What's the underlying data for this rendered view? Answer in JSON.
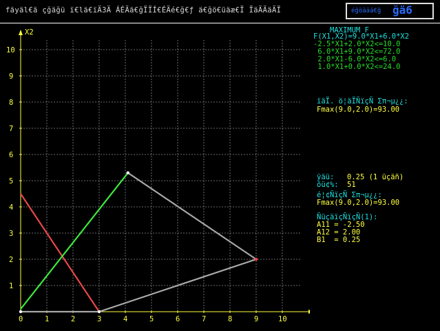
{
  "header": {
    "title": "fäyäl€ä çğäğü ï€lä€ïÄ3Ä ÁÉÄä€ğÏÏÍ€ÉÄé€ğ€ƒ ä€ğö€üäæ€Ï ÏäÄÄäÄÏ",
    "box_label": "éğöäää€ğ",
    "box_value": "ğä6"
  },
  "problem": {
    "heading": "MAXIMUM F",
    "objective": "F(X1,X2)=9.0*X1+6.0*X2",
    "constraints": [
      "-2.5*X1+2.0*X2<=10.0",
      " 6.0*X1+9.0*X2<=72.0",
      " 2.0*X1-6.0*X2<=6.0",
      " 1.0*X1+0.0*X2<=24.0"
    ]
  },
  "result1": {
    "label": "ïäÏ. ö¦äÏÑïçÑ Σπ¬µ¿¿:",
    "value": "Fmax(9.0,2.0)=93.00"
  },
  "step": {
    "label1": "ÿäü:",
    "value1": "0.25 (1 üçäñ)",
    "label2": "õü¢%:",
    "value2": "51"
  },
  "result2": {
    "label": "é¦¢ÑïçÑ Σπ¬µ¿¿:",
    "value": "Fmax(9.0,2.0)=93.00"
  },
  "coef": {
    "label": "ÑüçäïçÑïçÑ(1):",
    "lines": [
      "A11 = -2.50",
      "A12 = 2.00",
      "B1  = 0.25"
    ]
  },
  "chart_data": {
    "type": "line",
    "xlabel": "X1",
    "ylabel": "X2",
    "x_ticks": [
      0,
      1,
      2,
      3,
      4,
      5,
      6,
      7,
      8,
      9,
      10
    ],
    "y_ticks": [
      1,
      2,
      3,
      4,
      5,
      6,
      7,
      8,
      9,
      10
    ],
    "xlim": [
      0,
      11
    ],
    "ylim": [
      0,
      10.5
    ],
    "grid": true,
    "lines": [
      {
        "color": "#e84848",
        "points": [
          [
            0,
            4.5
          ],
          [
            3,
            0
          ]
        ]
      },
      {
        "color": "#3ee83e",
        "points": [
          [
            0,
            0.1
          ],
          [
            4.1,
            5.3
          ]
        ]
      },
      {
        "color": "#a8a8a8",
        "points": [
          [
            0,
            0
          ],
          [
            3,
            0
          ],
          [
            9,
            2
          ],
          [
            4.1,
            5.3
          ]
        ]
      }
    ],
    "points": [
      {
        "x": 0,
        "y": 0,
        "color": "#ffffff"
      },
      {
        "x": 3,
        "y": 0,
        "color": "#ffffff"
      },
      {
        "x": 9,
        "y": 2,
        "color": "#ff4040"
      },
      {
        "x": 4.1,
        "y": 5.3,
        "color": "#ffffff"
      }
    ]
  }
}
